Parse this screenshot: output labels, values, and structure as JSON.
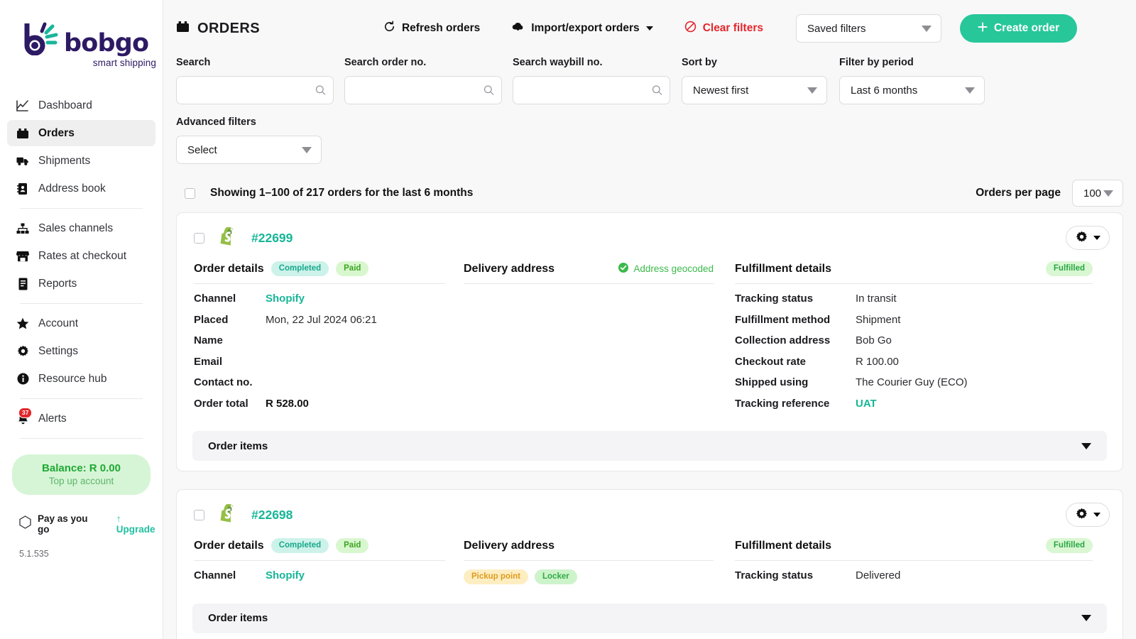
{
  "brand": {
    "name": "bobgo",
    "tagline": "smart shipping",
    "accent": "#27c79a",
    "logo_purple": "#2d1a64",
    "logo_teal": "#16b697"
  },
  "sidebar": {
    "groups": [
      {
        "items": [
          {
            "icon": "chart-line-icon",
            "label": "Dashboard",
            "active": false
          },
          {
            "icon": "orders-box-icon",
            "label": "Orders",
            "active": true
          },
          {
            "icon": "truck-icon",
            "label": "Shipments",
            "active": false
          },
          {
            "icon": "address-book-icon",
            "label": "Address book",
            "active": false
          }
        ]
      },
      {
        "items": [
          {
            "icon": "sitemap-icon",
            "label": "Sales channels",
            "active": false
          },
          {
            "icon": "storefront-icon",
            "label": "Rates at checkout",
            "active": false
          },
          {
            "icon": "report-icon",
            "label": "Reports",
            "active": false
          }
        ]
      },
      {
        "items": [
          {
            "icon": "star-icon",
            "label": "Account",
            "active": false
          },
          {
            "icon": "gear-icon",
            "label": "Settings",
            "active": false
          },
          {
            "icon": "info-circle-icon",
            "label": "Resource hub",
            "active": false
          }
        ]
      },
      {
        "items": [
          {
            "icon": "bell-icon",
            "label": "Alerts",
            "active": false,
            "badge": "37"
          }
        ]
      }
    ],
    "balance": {
      "main": "Balance: R 0.00",
      "sub": "Top up account"
    },
    "plan": {
      "name": "Pay as you go",
      "upgrade": "↑ Upgrade"
    },
    "version": "5.1.535"
  },
  "topbar": {
    "title": "ORDERS",
    "refresh_label": "Refresh orders",
    "import_export_label": "Import/export orders",
    "clear_filters_label": "Clear filters",
    "saved_filters_label": "Saved filters",
    "create_order_label": "Create order"
  },
  "filters": {
    "search": {
      "label": "Search",
      "value": "",
      "placeholder": ""
    },
    "order_no": {
      "label": "Search order no.",
      "value": "",
      "placeholder": ""
    },
    "waybill_no": {
      "label": "Search waybill no.",
      "value": "",
      "placeholder": ""
    },
    "sort_by": {
      "label": "Sort by",
      "value": "Newest first"
    },
    "period": {
      "label": "Filter by period",
      "value": "Last 6 months"
    },
    "advanced": {
      "label": "Advanced filters",
      "value": "Select"
    }
  },
  "list": {
    "showing_text": "Showing 1–100 of 217 orders for the last 6 months",
    "per_page_label": "Orders per page",
    "per_page_value": "100"
  },
  "orders": [
    {
      "channel_icon": "shopify-icon",
      "number": "#22699",
      "details": {
        "title": "Order details",
        "badges": [
          {
            "text": "Completed",
            "style": "b-completed"
          },
          {
            "text": "Paid",
            "style": "b-paid"
          }
        ],
        "rows": [
          {
            "key": "Channel",
            "value": "Shopify",
            "style": "link"
          },
          {
            "key": "Placed",
            "value": "Mon, 22 Jul 2024 06:21",
            "style": ""
          },
          {
            "key": "Name",
            "value": "",
            "style": ""
          },
          {
            "key": "Email",
            "value": "",
            "style": ""
          },
          {
            "key": "Contact no.",
            "value": "",
            "style": ""
          },
          {
            "key": "Order total",
            "value": "R 528.00",
            "style": "bold"
          }
        ]
      },
      "delivery": {
        "title": "Delivery address",
        "geocoded": "Address geocoded",
        "badges": []
      },
      "fulfillment": {
        "title": "Fulfillment details",
        "badge": {
          "text": "Fulfilled",
          "style": "b-fulfilled"
        },
        "rows": [
          {
            "key": "Tracking status",
            "value": "In transit",
            "style": ""
          },
          {
            "key": "Fulfillment method",
            "value": "Shipment",
            "style": ""
          },
          {
            "key": "Collection address",
            "value": "Bob Go",
            "style": ""
          },
          {
            "key": "Checkout rate",
            "value": "R 100.00",
            "style": ""
          },
          {
            "key": "Shipped using",
            "value": "The Courier Guy (ECO)",
            "style": ""
          },
          {
            "key": "Tracking reference",
            "value": "UAT",
            "style": "link"
          }
        ]
      },
      "order_items_label": "Order items"
    },
    {
      "channel_icon": "shopify-icon",
      "number": "#22698",
      "details": {
        "title": "Order details",
        "badges": [
          {
            "text": "Completed",
            "style": "b-completed"
          },
          {
            "text": "Paid",
            "style": "b-paid"
          }
        ],
        "rows": [
          {
            "key": "Channel",
            "value": "Shopify",
            "style": "link"
          }
        ]
      },
      "delivery": {
        "title": "Delivery address",
        "geocoded": "",
        "badges": [
          {
            "text": "Pickup point",
            "style": "b-pickup"
          },
          {
            "text": "Locker",
            "style": "b-locker"
          }
        ]
      },
      "fulfillment": {
        "title": "Fulfillment details",
        "badge": {
          "text": "Fulfilled",
          "style": "b-fulfilled"
        },
        "rows": [
          {
            "key": "Tracking status",
            "value": "Delivered",
            "style": ""
          }
        ]
      },
      "order_items_label": "Order items"
    }
  ]
}
